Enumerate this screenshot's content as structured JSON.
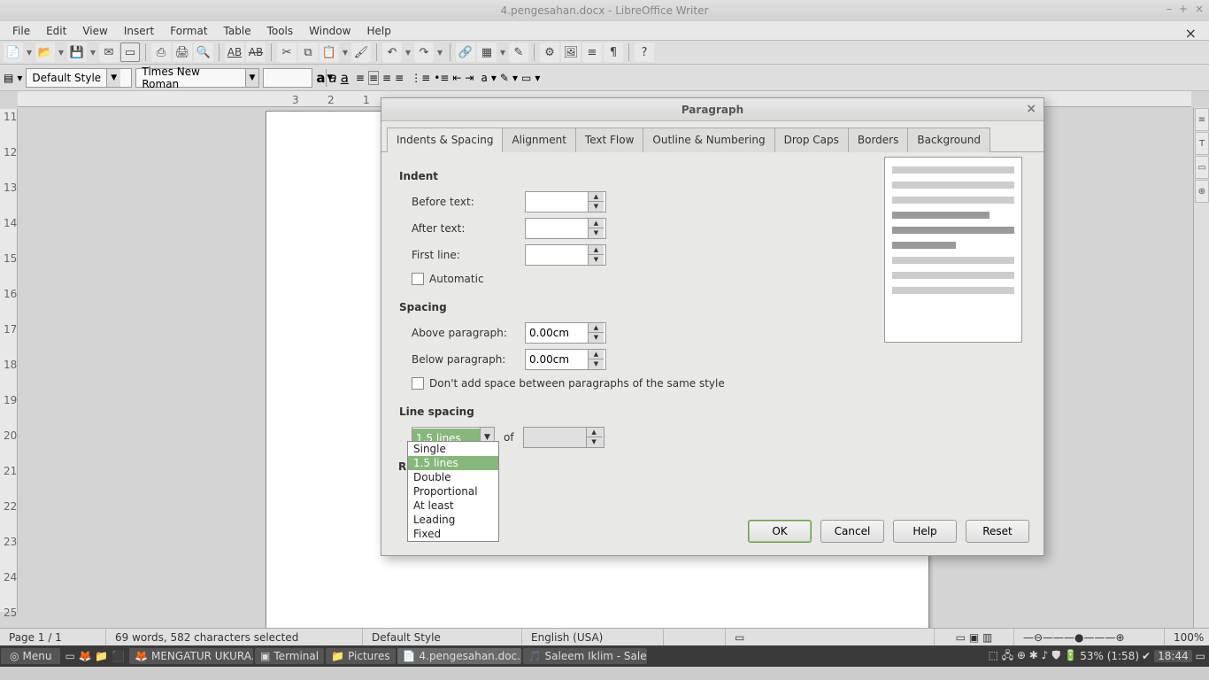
{
  "titlebar": {
    "text": "4.pengesahan.docx - LibreOffice Writer"
  },
  "menus": [
    "File",
    "Edit",
    "View",
    "Insert",
    "Format",
    "Table",
    "Tools",
    "Window",
    "Help"
  ],
  "fmt": {
    "style": "Default Style",
    "font": "Times New Roman",
    "size": ""
  },
  "ruler_h": [
    "3",
    "2",
    "1"
  ],
  "ruler_v": [
    "11",
    "12",
    "13",
    "14",
    "15",
    "16",
    "17",
    "18",
    "19",
    "20",
    "21",
    "22",
    "23",
    "24",
    "25"
  ],
  "status": {
    "page": "Page 1 / 1",
    "words": "69 words, 582 characters selected",
    "style": "Default Style",
    "lang": "English (USA)",
    "zoom": "100%"
  },
  "dialog": {
    "title": "Paragraph",
    "tabs": [
      "Indents & Spacing",
      "Alignment",
      "Text Flow",
      "Outline & Numbering",
      "Drop Caps",
      "Borders",
      "Background"
    ],
    "sections": {
      "indent": "Indent",
      "spacing": "Spacing",
      "linespacing": "Line spacing",
      "re": "Re"
    },
    "labels": {
      "before": "Before text:",
      "after": "After text:",
      "first": "First line:",
      "auto": "Automatic",
      "above": "Above paragraph:",
      "below": "Below paragraph:",
      "nospace": "Don't add space between paragraphs of the same style",
      "of": "of"
    },
    "values": {
      "before": "",
      "after": "",
      "first": "",
      "above": "0.00cm",
      "below": "0.00cm",
      "of": ""
    },
    "linespacing_val": "1.5 lines",
    "linespacing_opts": [
      "Single",
      "1.5 lines",
      "Double",
      "Proportional",
      "At least",
      "Leading",
      "Fixed"
    ],
    "buttons": {
      "ok": "OK",
      "cancel": "Cancel",
      "help": "Help",
      "reset": "Reset"
    }
  },
  "taskbar": {
    "menu": "Menu",
    "tasks": [
      "MENGATUR UKURA...",
      "Terminal",
      "Pictures",
      "4.pengesahan.doc...",
      "Saleem Iklim - Sale..."
    ],
    "battery": "53% (1:58)",
    "clock": "18:44"
  }
}
